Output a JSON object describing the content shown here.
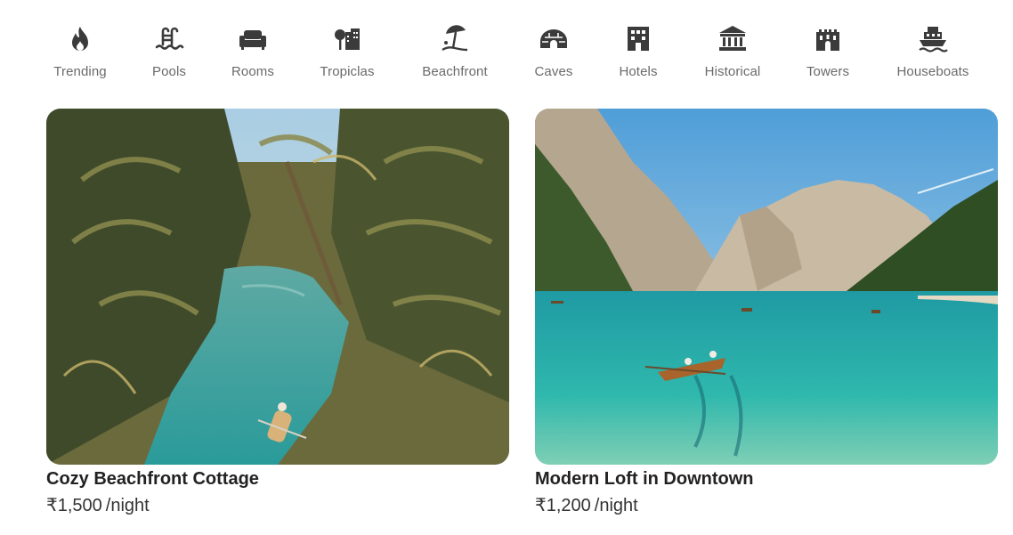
{
  "categories": [
    {
      "label": "Trending",
      "icon": "flame-icon"
    },
    {
      "label": "Pools",
      "icon": "pool-ladder-icon"
    },
    {
      "label": "Rooms",
      "icon": "sofa-icon"
    },
    {
      "label": "Tropiclas",
      "icon": "tropical-tree-building-icon"
    },
    {
      "label": "Beachfront",
      "icon": "beach-umbrella-icon"
    },
    {
      "label": "Caves",
      "icon": "igloo-cave-icon"
    },
    {
      "label": "Hotels",
      "icon": "hotel-building-icon"
    },
    {
      "label": "Historical",
      "icon": "museum-columns-icon"
    },
    {
      "label": "Towers",
      "icon": "castle-tower-icon"
    },
    {
      "label": "Houseboats",
      "icon": "houseboat-icon"
    }
  ],
  "listings": [
    {
      "title": "Cozy Beachfront Cottage",
      "price": "₹1,500",
      "unit": "/night",
      "image": "tropical-river-palms-photo"
    },
    {
      "title": "Modern Loft in Downtown",
      "price": "₹1,200",
      "unit": "/night",
      "image": "mountain-lake-rowboat-photo"
    }
  ],
  "colors": {
    "icon": "#3b3b3b",
    "label": "#6a6a6a",
    "title": "#222222"
  }
}
